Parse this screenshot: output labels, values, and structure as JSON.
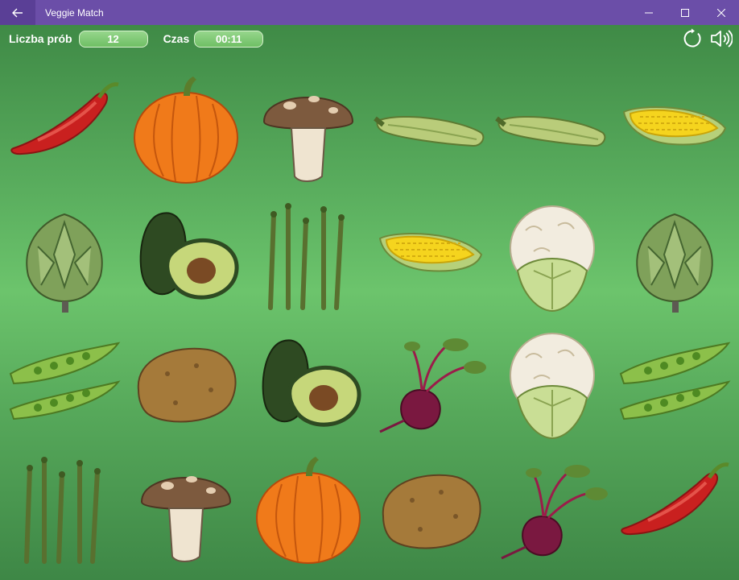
{
  "window": {
    "title": "Veggie Match"
  },
  "status": {
    "attempts_label": "Liczba prób",
    "attempts_value": "12",
    "time_label": "Czas",
    "time_value": "00:11"
  },
  "icons": {
    "back": "back-arrow-icon",
    "minimize": "minimize-icon",
    "maximize": "maximize-icon",
    "close": "close-icon",
    "restart": "restart-icon",
    "sound": "speaker-icon"
  },
  "board": {
    "rows": 4,
    "columns": 6,
    "cards": [
      [
        "chili-pepper",
        "pumpkin",
        "mushroom",
        "zucchini",
        "zucchini",
        "corn"
      ],
      [
        "artichoke",
        "avocado",
        "asparagus",
        "corn",
        "cauliflower",
        "artichoke"
      ],
      [
        "pea-pods",
        "potato",
        "avocado",
        "beet",
        "cauliflower",
        "pea-pods"
      ],
      [
        "asparagus",
        "mushroom",
        "pumpkin",
        "potato",
        "beet",
        "chili-pepper"
      ]
    ]
  },
  "colors": {
    "titlebar": "#6b4ea8",
    "pill": "#7fca72"
  }
}
